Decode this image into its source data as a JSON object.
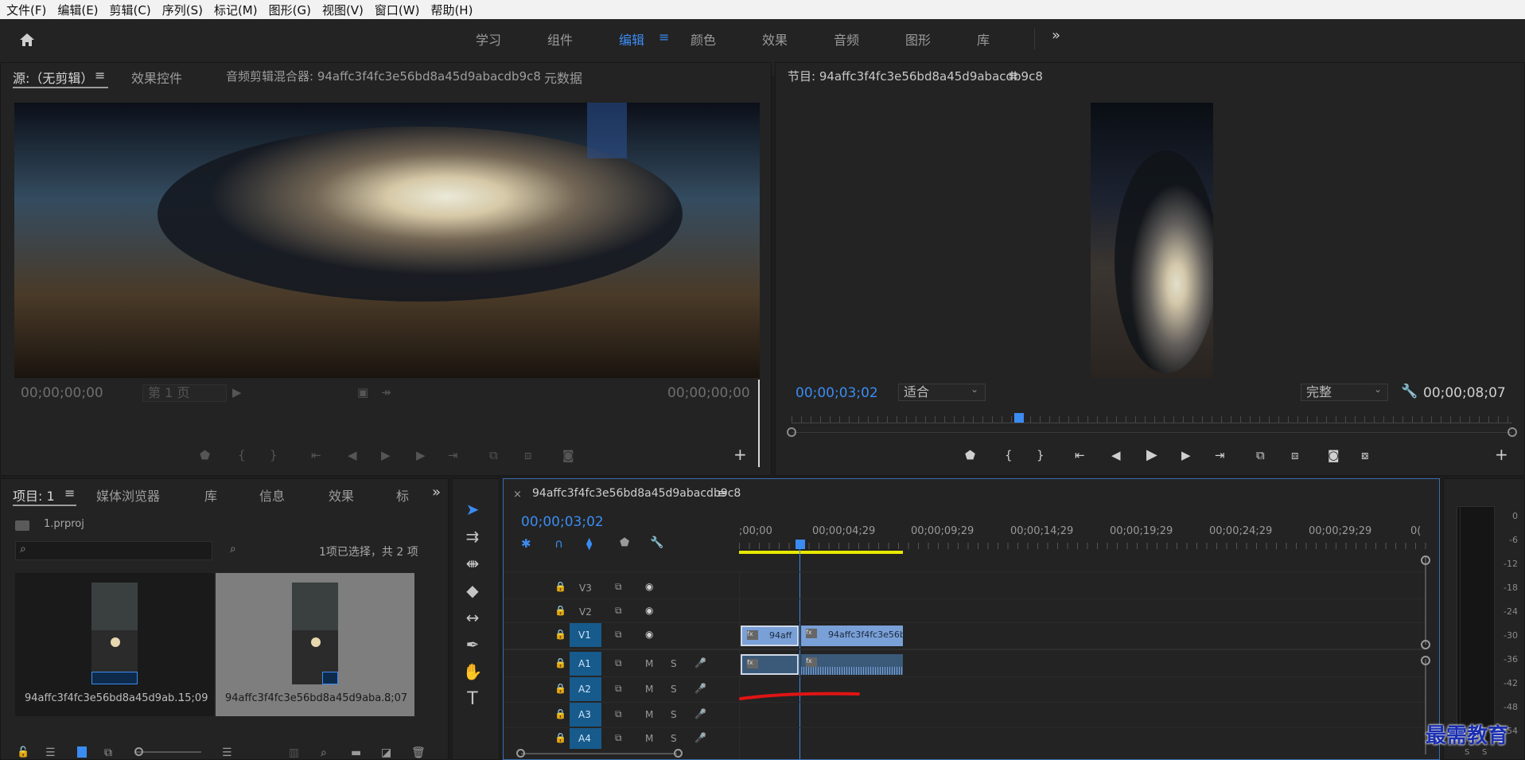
{
  "menu": [
    "文件(F)",
    "编辑(E)",
    "剪辑(C)",
    "序列(S)",
    "标记(M)",
    "图形(G)",
    "视图(V)",
    "窗口(W)",
    "帮助(H)"
  ],
  "workspaces": [
    "学习",
    "组件",
    "编辑",
    "颜色",
    "效果",
    "音频",
    "图形",
    "库"
  ],
  "workspace_active": "编辑",
  "source": {
    "tabs": [
      "源:（无剪辑）",
      "效果控件",
      "音频剪辑混合器: 94affc3f4fc3e56bd8a45d9abacdb9c8",
      "元数据"
    ],
    "timecode_left": "00;00;00;00",
    "page": "第 1 页",
    "timecode_right": "00;00;00;00"
  },
  "program": {
    "tab": "节目: 94affc3f4fc3e56bd8a45d9abacdb9c8",
    "timecode": "00;00;03;02",
    "fit": "适合",
    "quality": "完整",
    "duration": "00;00;08;07"
  },
  "project": {
    "tabs": [
      "项目: 1",
      "媒体浏览器",
      "库",
      "信息",
      "效果",
      "标"
    ],
    "file": "1.prproj",
    "selection": "1项已选择，共 2 项",
    "items": [
      {
        "name": "94affc3f4fc3e56bd8a45d9ab...",
        "dur": "15;09"
      },
      {
        "name": "94affc3f4fc3e56bd8a45d9aba...",
        "dur": "8;07"
      }
    ]
  },
  "timeline": {
    "tab": "94affc3f4fc3e56bd8a45d9abacdb9c8",
    "timecode": "00;00;03;02",
    "ruler": [
      ";00;00",
      "00;00;04;29",
      "00;00;09;29",
      "00;00;14;29",
      "00;00;19;29",
      "00;00;24;29",
      "00;00;29;29",
      "0("
    ],
    "video_tracks": [
      "V3",
      "V2",
      "V1"
    ],
    "audio_tracks": [
      "A1",
      "A2",
      "A3",
      "A4"
    ],
    "clip_v1a": "94aff",
    "clip_v1b": "94affc3f4fc3e56b",
    "m_label": "M",
    "s_label": "S"
  },
  "meter": [
    "0",
    "-6",
    "-12",
    "-18",
    "-24",
    "-30",
    "-36",
    "-42",
    "-48",
    "-54"
  ],
  "meter_ss": [
    "S",
    "S"
  ],
  "watermark": "最需教育"
}
